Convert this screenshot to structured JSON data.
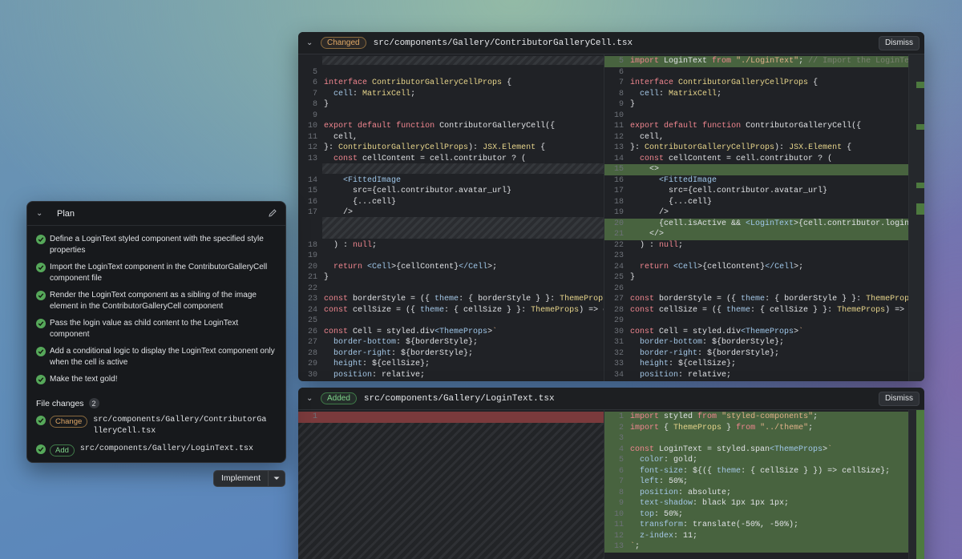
{
  "panel1": {
    "badge": "Changed",
    "path": "src/components/Gallery/ContributorGalleryCell.tsx",
    "dismiss": "Dismiss",
    "left_lines": [
      {
        "n": "",
        "code": ""
      },
      {
        "n": "5",
        "code": ""
      },
      {
        "n": "6",
        "code": "interface ContributorGalleryCellProps {"
      },
      {
        "n": "7",
        "code": "  cell: MatrixCell;"
      },
      {
        "n": "8",
        "code": "}"
      },
      {
        "n": "9",
        "code": ""
      },
      {
        "n": "10",
        "code": "export default function ContributorGalleryCell({"
      },
      {
        "n": "11",
        "code": "  cell,"
      },
      {
        "n": "12",
        "code": "}: ContributorGalleryCellProps): JSX.Element {"
      },
      {
        "n": "13",
        "code": "  const cellContent = cell.contributor ? ("
      },
      {
        "n": "",
        "code": ""
      },
      {
        "n": "14",
        "code": "    <FittedImage"
      },
      {
        "n": "15",
        "code": "      src={cell.contributor.avatar_url}"
      },
      {
        "n": "16",
        "code": "      {...cell}"
      },
      {
        "n": "17",
        "code": "    />"
      },
      {
        "n": "",
        "code": ""
      },
      {
        "n": "",
        "code": ""
      },
      {
        "n": "18",
        "code": "  ) : null;"
      },
      {
        "n": "19",
        "code": ""
      },
      {
        "n": "20",
        "code": "  return <Cell>{cellContent}</Cell>;"
      },
      {
        "n": "21",
        "code": "}"
      },
      {
        "n": "22",
        "code": ""
      },
      {
        "n": "23",
        "code": "const borderStyle = ({ theme: { borderStyle } }: ThemeProps) =>"
      },
      {
        "n": "24",
        "code": "const cellSize = ({ theme: { cellSize } }: ThemeProps) => cellSi"
      },
      {
        "n": "25",
        "code": ""
      },
      {
        "n": "26",
        "code": "const Cell = styled.div<ThemeProps>`"
      },
      {
        "n": "27",
        "code": "  border-bottom: ${borderStyle};"
      },
      {
        "n": "28",
        "code": "  border-right: ${borderStyle};"
      },
      {
        "n": "29",
        "code": "  height: ${cellSize};"
      },
      {
        "n": "30",
        "code": "  position: relative;"
      }
    ],
    "right_lines": [
      {
        "n": "5",
        "code": "import LoginText from \"./LoginText\"; // Import the LoginText com"
      },
      {
        "n": "6",
        "code": ""
      },
      {
        "n": "7",
        "code": "interface ContributorGalleryCellProps {"
      },
      {
        "n": "8",
        "code": "  cell: MatrixCell;"
      },
      {
        "n": "9",
        "code": "}"
      },
      {
        "n": "10",
        "code": ""
      },
      {
        "n": "11",
        "code": "export default function ContributorGalleryCell({"
      },
      {
        "n": "12",
        "code": "  cell,"
      },
      {
        "n": "13",
        "code": "}: ContributorGalleryCellProps): JSX.Element {"
      },
      {
        "n": "14",
        "code": "  const cellContent = cell.contributor ? ("
      },
      {
        "n": "15",
        "code": "    <>"
      },
      {
        "n": "16",
        "code": "      <FittedImage"
      },
      {
        "n": "17",
        "code": "        src={cell.contributor.avatar_url}"
      },
      {
        "n": "18",
        "code": "        {...cell}"
      },
      {
        "n": "19",
        "code": "      />"
      },
      {
        "n": "20",
        "code": "      {cell.isActive && <LoginText>{cell.contributor.login}</Log"
      },
      {
        "n": "21",
        "code": "    </>"
      },
      {
        "n": "22",
        "code": "  ) : null;"
      },
      {
        "n": "23",
        "code": ""
      },
      {
        "n": "24",
        "code": "  return <Cell>{cellContent}</Cell>;"
      },
      {
        "n": "25",
        "code": "}"
      },
      {
        "n": "26",
        "code": ""
      },
      {
        "n": "27",
        "code": "const borderStyle = ({ theme: { borderStyle } }: ThemeProps) =>"
      },
      {
        "n": "28",
        "code": "const cellSize = ({ theme: { cellSize } }: ThemeProps) => cellSi"
      },
      {
        "n": "29",
        "code": ""
      },
      {
        "n": "30",
        "code": "const Cell = styled.div<ThemeProps>`"
      },
      {
        "n": "31",
        "code": "  border-bottom: ${borderStyle};"
      },
      {
        "n": "32",
        "code": "  border-right: ${borderStyle};"
      },
      {
        "n": "33",
        "code": "  height: ${cellSize};"
      },
      {
        "n": "34",
        "code": "  position: relative;"
      }
    ]
  },
  "panel2": {
    "badge": "Added",
    "path": "src/components/Gallery/LoginText.tsx",
    "dismiss": "Dismiss",
    "left_lines": [
      {
        "n": "1",
        "code": ""
      }
    ],
    "right_lines": [
      {
        "n": "1",
        "code": "import styled from \"styled-components\";"
      },
      {
        "n": "2",
        "code": "import { ThemeProps } from \"../theme\";"
      },
      {
        "n": "3",
        "code": ""
      },
      {
        "n": "4",
        "code": "const LoginText = styled.span<ThemeProps>`"
      },
      {
        "n": "5",
        "code": "  color: gold;"
      },
      {
        "n": "6",
        "code": "  font-size: ${({ theme: { cellSize } }) => cellSize};"
      },
      {
        "n": "7",
        "code": "  left: 50%;"
      },
      {
        "n": "8",
        "code": "  position: absolute;"
      },
      {
        "n": "9",
        "code": "  text-shadow: black 1px 1px 1px;"
      },
      {
        "n": "10",
        "code": "  top: 50%;"
      },
      {
        "n": "11",
        "code": "  transform: translate(-50%, -50%);"
      },
      {
        "n": "12",
        "code": "  z-index: 11;"
      },
      {
        "n": "13",
        "code": "`;"
      }
    ]
  },
  "plan": {
    "title": "Plan",
    "steps": [
      "Define a LoginText styled component with the specified style properties",
      "Import the LoginText component in the ContributorGalleryCell component file",
      "Render the LoginText component as a sibling of the image element in the ContributorGalleryCell component",
      "Pass the login value as child content to the LoginText component",
      "Add a conditional logic to display the LoginText component only when the cell is active",
      "Make the text gold!"
    ],
    "file_changes_label": "File changes",
    "file_changes_count": "2",
    "files": [
      {
        "badge": "Change",
        "path": "src/components/Gallery/ContributorGalleryCell.tsx"
      },
      {
        "badge": "Add",
        "path": "src/components/Gallery/LoginText.tsx"
      }
    ],
    "implement": "Implement"
  }
}
